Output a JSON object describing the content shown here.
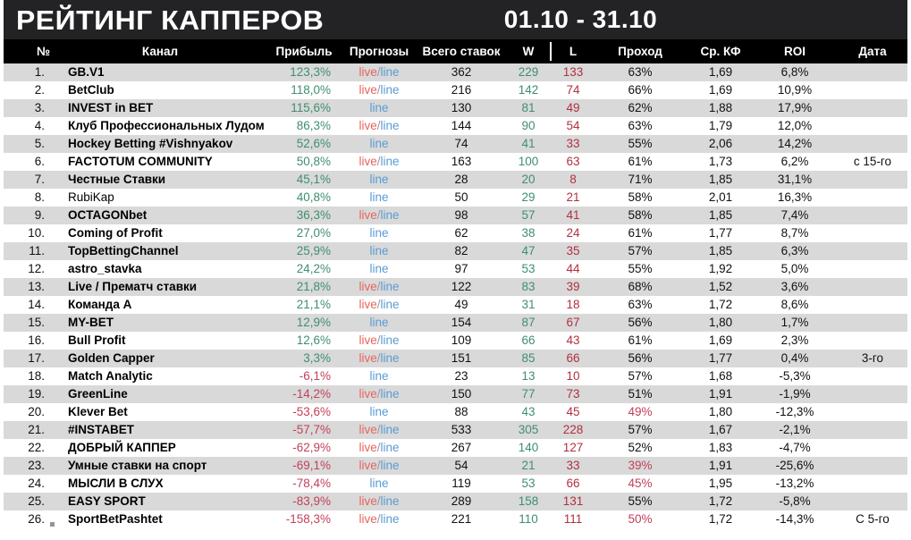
{
  "header": {
    "title": "РЕЙТИНГ КАППЕРОВ",
    "period": "01.10 - 31.10",
    "bar_color": "#232325"
  },
  "table": {
    "columns": [
      {
        "key": "num",
        "label": "№"
      },
      {
        "key": "chan",
        "label": "Канал"
      },
      {
        "key": "profit",
        "label": "Прибыль"
      },
      {
        "key": "forc",
        "label": "Прогнозы"
      },
      {
        "key": "total",
        "label": "Всего ставок"
      },
      {
        "key": "w",
        "label": "W"
      },
      {
        "key": "l",
        "label": "L"
      },
      {
        "key": "pass",
        "label": "Проход"
      },
      {
        "key": "koef",
        "label": "Ср. КФ"
      },
      {
        "key": "roi",
        "label": "ROI"
      },
      {
        "key": "date",
        "label": "Дата"
      }
    ],
    "colors": {
      "header_bg": "#000000",
      "row_odd": "#d9d9d9",
      "row_even": "#ffffff",
      "positive": "#3f8f6e",
      "negative": "#c2415a",
      "live": "#e8635e",
      "line": "#5b9bd5"
    },
    "rows": [
      {
        "num": "1.",
        "chan": "GB.V1",
        "bold": true,
        "profit": "123,3%",
        "profit_sign": "pos",
        "forc": "live/line",
        "total": "362",
        "w": "229",
        "l": "133",
        "pass": "63%",
        "pass_bad": false,
        "koef": "1,69",
        "roi": "6,8%",
        "date": ""
      },
      {
        "num": "2.",
        "chan": "BetClub",
        "bold": true,
        "profit": "118,0%",
        "profit_sign": "pos",
        "forc": "live/line",
        "total": "216",
        "w": "142",
        "l": "74",
        "pass": "66%",
        "pass_bad": false,
        "koef": "1,69",
        "roi": "10,9%",
        "date": ""
      },
      {
        "num": "3.",
        "chan": "INVEST in BET",
        "bold": true,
        "profit": "115,6%",
        "profit_sign": "pos",
        "forc": "line",
        "total": "130",
        "w": "81",
        "l": "49",
        "pass": "62%",
        "pass_bad": false,
        "koef": "1,88",
        "roi": "17,9%",
        "date": ""
      },
      {
        "num": "4.",
        "chan": "Клуб Профессиональных Лудом",
        "bold": true,
        "profit": "86,3%",
        "profit_sign": "pos",
        "forc": "live/line",
        "total": "144",
        "w": "90",
        "l": "54",
        "pass": "63%",
        "pass_bad": false,
        "koef": "1,79",
        "roi": "12,0%",
        "date": ""
      },
      {
        "num": "5.",
        "chan": "Hockey Betting #Vishnyakov",
        "bold": true,
        "profit": "52,6%",
        "profit_sign": "pos",
        "forc": "line",
        "total": "74",
        "w": "41",
        "l": "33",
        "pass": "55%",
        "pass_bad": false,
        "koef": "2,06",
        "roi": "14,2%",
        "date": ""
      },
      {
        "num": "6.",
        "chan": "FACTOTUM COMMUNITY",
        "bold": true,
        "profit": "50,8%",
        "profit_sign": "pos",
        "forc": "live/line",
        "total": "163",
        "w": "100",
        "l": "63",
        "pass": "61%",
        "pass_bad": false,
        "koef": "1,73",
        "roi": "6,2%",
        "date": "с 15-го"
      },
      {
        "num": "7.",
        "chan": "Честные Ставки",
        "bold": true,
        "profit": "45,1%",
        "profit_sign": "pos",
        "forc": "line",
        "total": "28",
        "w": "20",
        "l": "8",
        "pass": "71%",
        "pass_bad": false,
        "koef": "1,85",
        "roi": "31,1%",
        "date": ""
      },
      {
        "num": "8.",
        "chan": "RubiKap",
        "bold": false,
        "profit": "40,8%",
        "profit_sign": "pos",
        "forc": "line",
        "total": "50",
        "w": "29",
        "l": "21",
        "pass": "58%",
        "pass_bad": false,
        "koef": "2,01",
        "roi": "16,3%",
        "date": ""
      },
      {
        "num": "9.",
        "chan": "OCTAGONbet",
        "bold": true,
        "profit": "36,3%",
        "profit_sign": "pos",
        "forc": "live/line",
        "total": "98",
        "w": "57",
        "l": "41",
        "pass": "58%",
        "pass_bad": false,
        "koef": "1,85",
        "roi": "7,4%",
        "date": ""
      },
      {
        "num": "10.",
        "chan": "Coming of Profit",
        "bold": true,
        "profit": "27,0%",
        "profit_sign": "pos",
        "forc": "line",
        "total": "62",
        "w": "38",
        "l": "24",
        "pass": "61%",
        "pass_bad": false,
        "koef": "1,77",
        "roi": "8,7%",
        "date": ""
      },
      {
        "num": "11.",
        "chan": "TopBettingChannel",
        "bold": true,
        "profit": "25,9%",
        "profit_sign": "pos",
        "forc": "line",
        "total": "82",
        "w": "47",
        "l": "35",
        "pass": "57%",
        "pass_bad": false,
        "koef": "1,85",
        "roi": "6,3%",
        "date": ""
      },
      {
        "num": "12.",
        "chan": "astro_stavka",
        "bold": true,
        "profit": "24,2%",
        "profit_sign": "pos",
        "forc": "line",
        "total": "97",
        "w": "53",
        "l": "44",
        "pass": "55%",
        "pass_bad": false,
        "koef": "1,92",
        "roi": "5,0%",
        "date": ""
      },
      {
        "num": "13.",
        "chan": "Live / Прематч ставки",
        "bold": true,
        "profit": "21,8%",
        "profit_sign": "pos",
        "forc": "live/line",
        "total": "122",
        "w": "83",
        "l": "39",
        "pass": "68%",
        "pass_bad": false,
        "koef": "1,52",
        "roi": "3,6%",
        "date": ""
      },
      {
        "num": "14.",
        "chan": "Команда А",
        "bold": true,
        "profit": "21,1%",
        "profit_sign": "pos",
        "forc": "live/line",
        "total": "49",
        "w": "31",
        "l": "18",
        "pass": "63%",
        "pass_bad": false,
        "koef": "1,72",
        "roi": "8,6%",
        "date": ""
      },
      {
        "num": "15.",
        "chan": "MY-BET",
        "bold": true,
        "profit": "12,9%",
        "profit_sign": "pos",
        "forc": "line",
        "total": "154",
        "w": "87",
        "l": "67",
        "pass": "56%",
        "pass_bad": false,
        "koef": "1,80",
        "roi": "1,7%",
        "date": ""
      },
      {
        "num": "16.",
        "chan": "Bull Profit",
        "bold": true,
        "profit": "12,6%",
        "profit_sign": "pos",
        "forc": "live/line",
        "total": "109",
        "w": "66",
        "l": "43",
        "pass": "61%",
        "pass_bad": false,
        "koef": "1,69",
        "roi": "2,3%",
        "date": ""
      },
      {
        "num": "17.",
        "chan": "Golden Capper",
        "bold": true,
        "profit": "3,3%",
        "profit_sign": "pos",
        "forc": "live/line",
        "total": "151",
        "w": "85",
        "l": "66",
        "pass": "56%",
        "pass_bad": false,
        "koef": "1,77",
        "roi": "0,4%",
        "date": "3-го"
      },
      {
        "num": "18.",
        "chan": "Match Analytic",
        "bold": true,
        "profit": "-6,1%",
        "profit_sign": "neg",
        "forc": "line",
        "total": "23",
        "w": "13",
        "l": "10",
        "pass": "57%",
        "pass_bad": false,
        "koef": "1,68",
        "roi": "-5,3%",
        "date": ""
      },
      {
        "num": "19.",
        "chan": "GreenLine",
        "bold": true,
        "profit": "-14,2%",
        "profit_sign": "neg",
        "forc": "live/line",
        "total": "150",
        "w": "77",
        "l": "73",
        "pass": "51%",
        "pass_bad": false,
        "koef": "1,91",
        "roi": "-1,9%",
        "date": ""
      },
      {
        "num": "20.",
        "chan": "Klever Bet",
        "bold": true,
        "profit": "-53,6%",
        "profit_sign": "neg",
        "forc": "line",
        "total": "88",
        "w": "43",
        "l": "45",
        "pass": "49%",
        "pass_bad": true,
        "koef": "1,80",
        "roi": "-12,3%",
        "date": ""
      },
      {
        "num": "21.",
        "chan": "#INSTABET",
        "bold": true,
        "profit": "-57,7%",
        "profit_sign": "neg",
        "forc": "live/line",
        "total": "533",
        "w": "305",
        "l": "228",
        "pass": "57%",
        "pass_bad": false,
        "koef": "1,67",
        "roi": "-2,1%",
        "date": ""
      },
      {
        "num": "22.",
        "chan": "ДОБРЫЙ КАППЕР",
        "bold": true,
        "profit": "-62,9%",
        "profit_sign": "neg",
        "forc": "live/line",
        "total": "267",
        "w": "140",
        "l": "127",
        "pass": "52%",
        "pass_bad": false,
        "koef": "1,83",
        "roi": "-4,7%",
        "date": ""
      },
      {
        "num": "23.",
        "chan": "Умные ставки на спорт",
        "bold": true,
        "profit": "-69,1%",
        "profit_sign": "neg",
        "forc": "live/line",
        "total": "54",
        "w": "21",
        "l": "33",
        "pass": "39%",
        "pass_bad": true,
        "koef": "1,91",
        "roi": "-25,6%",
        "date": ""
      },
      {
        "num": "24.",
        "chan": "МЫСЛИ В СЛУХ",
        "bold": true,
        "profit": "-78,4%",
        "profit_sign": "neg",
        "forc": "line",
        "total": "119",
        "w": "53",
        "l": "66",
        "pass": "45%",
        "pass_bad": true,
        "koef": "1,95",
        "roi": "-13,2%",
        "date": ""
      },
      {
        "num": "25.",
        "chan": "EASY SPORT",
        "bold": true,
        "profit": "-83,9%",
        "profit_sign": "neg",
        "forc": "live/line",
        "total": "289",
        "w": "158",
        "l": "131",
        "pass": "55%",
        "pass_bad": false,
        "koef": "1,72",
        "roi": "-5,8%",
        "date": ""
      },
      {
        "num": "26.",
        "chan": "SportBetPashtet",
        "bold": true,
        "profit": "-158,3%",
        "profit_sign": "neg",
        "forc": "live/line",
        "total": "221",
        "w": "110",
        "l": "111",
        "pass": "50%",
        "pass_bad": true,
        "koef": "1,72",
        "roi": "-14,3%",
        "date": "С 5-го"
      }
    ]
  }
}
